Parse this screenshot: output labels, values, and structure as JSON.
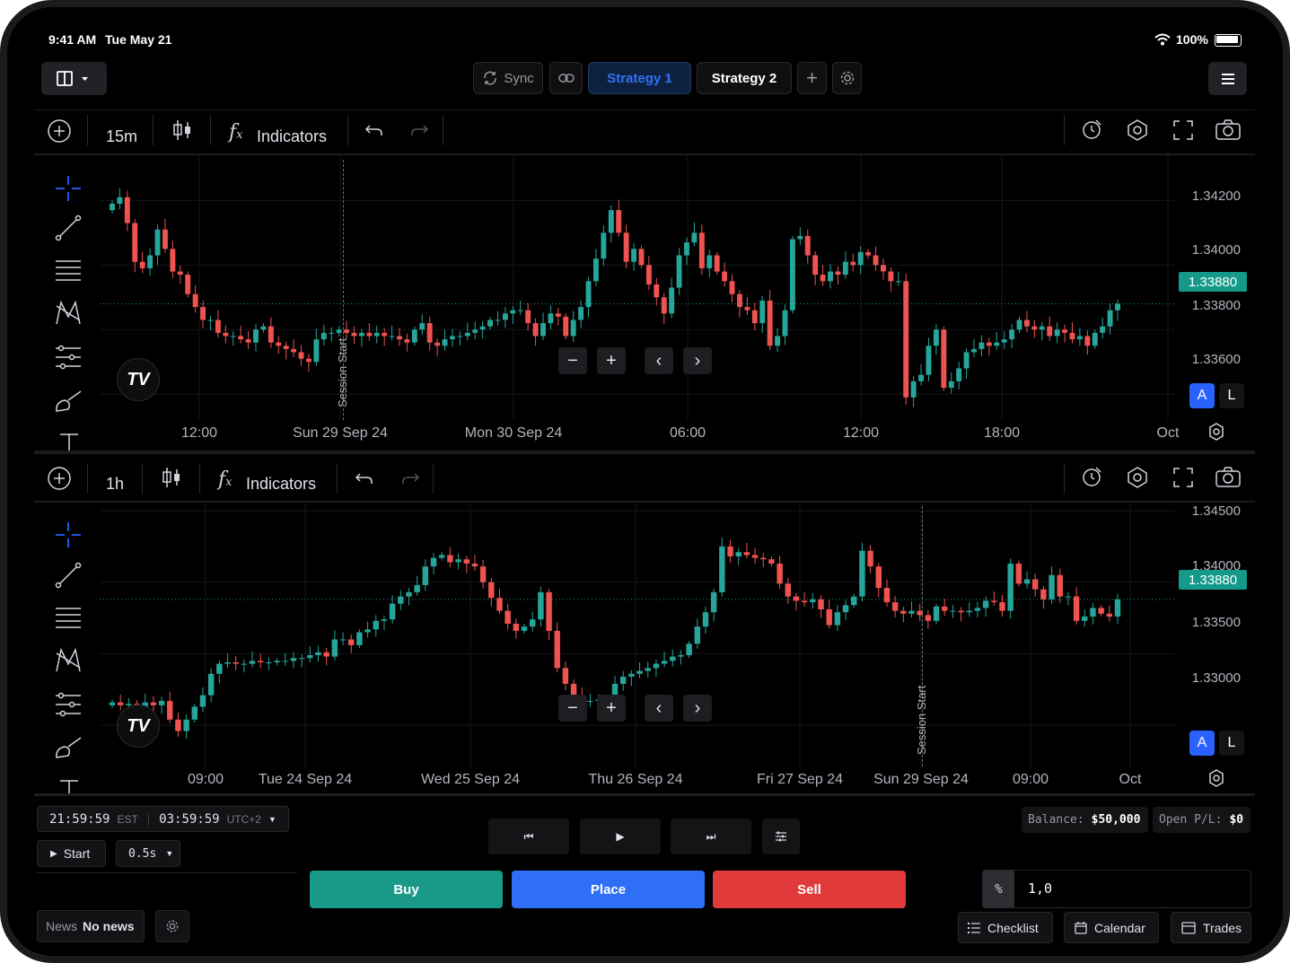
{
  "status_bar": {
    "time": "9:41 AM",
    "date": "Tue May 21",
    "battery": "100%",
    "icons": [
      "wifi-icon",
      "battery-icon"
    ]
  },
  "top_toolbar": {
    "layout_icon": "split-layout-icon",
    "sync_label": "Sync",
    "strategy_tabs": [
      {
        "label": "Strategy 1",
        "active": true
      },
      {
        "label": "Strategy 2",
        "active": false
      }
    ],
    "icons": [
      "link-icon",
      "plus-icon",
      "gear-icon",
      "menu-icon"
    ]
  },
  "chart_top": {
    "timeframe": "15m",
    "indicators_label": "Indicators",
    "last_price": "1.33880",
    "price_labels": [
      "1.34200",
      "1.34000",
      "1.33800",
      "1.33600"
    ],
    "time_labels": [
      "12:00",
      "Sun 29 Sep 24",
      "Mon 30 Sep 24",
      "06:00",
      "12:00",
      "18:00",
      "Oct"
    ],
    "session_label": "Session Start",
    "auto_label": "A",
    "log_label": "L"
  },
  "chart_bottom": {
    "timeframe": "1h",
    "indicators_label": "Indicators",
    "last_price": "1.33880",
    "price_labels": [
      "1.34500",
      "1.34000",
      "1.33500",
      "1.33000"
    ],
    "time_labels": [
      "09:00",
      "Tue 24 Sep 24",
      "Wed 25 Sep 24",
      "Thu 26 Sep 24",
      "Fri 27 Sep 24",
      "Sun 29 Sep 24",
      "09:00",
      "Oct"
    ],
    "session_label": "Session Start",
    "auto_label": "A",
    "log_label": "L"
  },
  "chart_data": [
    {
      "type": "candlestick",
      "timeframe": "15m",
      "ylim": [
        1.3352,
        1.3434
      ],
      "price_ticks": [
        1.342,
        1.34,
        1.338,
        1.336
      ],
      "last_price": 1.3388,
      "closes": [
        1.3419,
        1.3421,
        1.3413,
        1.3401,
        1.3399,
        1.3403,
        1.3411,
        1.3405,
        1.3398,
        1.3397,
        1.3391,
        1.3387,
        1.3383,
        1.3383,
        1.3379,
        1.3378,
        1.3378,
        1.3377,
        1.3376,
        1.338,
        1.3381,
        1.3376,
        1.3375,
        1.3374,
        1.3373,
        1.3371,
        1.337,
        1.3377,
        1.3379,
        1.3379,
        1.338,
        1.3379,
        1.3378,
        1.3379,
        1.3378,
        1.3379,
        1.3378,
        1.3378,
        1.3377,
        1.3376,
        1.338,
        1.3382,
        1.3376,
        1.3375,
        1.3377,
        1.3378,
        1.3378,
        1.3379,
        1.338,
        1.3381,
        1.3383,
        1.3383,
        1.3385,
        1.3386,
        1.3386,
        1.3382,
        1.3378,
        1.3382,
        1.3385,
        1.3384,
        1.3378,
        1.3383,
        1.3387,
        1.3395,
        1.3402,
        1.341,
        1.3417,
        1.341,
        1.3401,
        1.3405,
        1.34,
        1.3394,
        1.339,
        1.3385,
        1.3393,
        1.3403,
        1.3407,
        1.341,
        1.3399,
        1.3403,
        1.3398,
        1.3395,
        1.3391,
        1.3387,
        1.3386,
        1.3382,
        1.3389,
        1.3375,
        1.3378,
        1.3386,
        1.3408,
        1.3409,
        1.3403,
        1.3397,
        1.3395,
        1.3398,
        1.3397,
        1.3401,
        1.34,
        1.3404,
        1.3403,
        1.34,
        1.3398,
        1.3395,
        1.3395,
        1.3359,
        1.3364,
        1.3366,
        1.3375,
        1.338,
        1.3362,
        1.3364,
        1.3368,
        1.3373,
        1.3374,
        1.3376,
        1.3375,
        1.3376,
        1.3377,
        1.338,
        1.3383,
        1.3381,
        1.338,
        1.3381,
        1.3378,
        1.338,
        1.3379,
        1.3377,
        1.3378,
        1.3375,
        1.3379,
        1.3381,
        1.3386,
        1.3388
      ]
    },
    {
      "type": "candlestick",
      "timeframe": "1h",
      "ylim": [
        1.327,
        1.3455
      ],
      "price_ticks": [
        1.345,
        1.34,
        1.335,
        1.33
      ],
      "last_price": 1.3388,
      "closes": [
        1.3316,
        1.3314,
        1.3315,
        1.3313,
        1.3316,
        1.3314,
        1.3317,
        1.3304,
        1.3296,
        1.3304,
        1.3313,
        1.3321,
        1.3336,
        1.3343,
        1.3344,
        1.3343,
        1.3343,
        1.3345,
        1.3344,
        1.3344,
        1.3345,
        1.3345,
        1.3347,
        1.3347,
        1.3349,
        1.3351,
        1.3348,
        1.336,
        1.336,
        1.3356,
        1.3365,
        1.3367,
        1.3373,
        1.3374,
        1.3385,
        1.339,
        1.3393,
        1.3398,
        1.3411,
        1.3417,
        1.3419,
        1.3414,
        1.3416,
        1.3413,
        1.3411,
        1.34,
        1.3389,
        1.338,
        1.3371,
        1.3366,
        1.3369,
        1.3374,
        1.3393,
        1.3366,
        1.334,
        1.3329,
        1.332,
        1.3317,
        1.3317,
        1.3318,
        1.3317,
        1.3329,
        1.3334,
        1.3336,
        1.3338,
        1.334,
        1.3343,
        1.3345,
        1.3348,
        1.3349,
        1.3357,
        1.3369,
        1.3379,
        1.3393,
        1.3425,
        1.3418,
        1.3421,
        1.3419,
        1.3417,
        1.3416,
        1.3413,
        1.3399,
        1.339,
        1.3387,
        1.3386,
        1.3388,
        1.3381,
        1.337,
        1.3379,
        1.3384,
        1.339,
        1.3422,
        1.3411,
        1.3396,
        1.3386,
        1.338,
        1.3378,
        1.338,
        1.3377,
        1.3373,
        1.3383,
        1.338,
        1.338,
        1.3379,
        1.338,
        1.3382,
        1.3387,
        1.3386,
        1.338,
        1.3413,
        1.3399,
        1.3402,
        1.3395,
        1.3388,
        1.3405,
        1.339,
        1.339,
        1.3373,
        1.3376,
        1.3382,
        1.3378,
        1.3376,
        1.3388
      ]
    }
  ],
  "bottom_panel": {
    "clock_est": "21:59:59",
    "clock_est_tz": "EST",
    "clock_local": "03:59:59",
    "clock_local_tz": "UTC+2",
    "start_label": "Start",
    "speed": "0.5s",
    "buy_label": "Buy",
    "place_label": "Place",
    "sell_label": "Sell",
    "balance_label": "Balance:",
    "balance_value": "$50,000",
    "openpl_label": "Open P/L:",
    "openpl_value": "$0",
    "qty_mode": "%",
    "qty_value": "1,0",
    "news_label": "News",
    "news_value": "No news",
    "checklist_label": "Checklist",
    "calendar_label": "Calendar",
    "trades_label": "Trades",
    "colors": {
      "buy": "#1a9988",
      "place": "#2f6ff5",
      "sell": "#e03a3a",
      "up": "#26a69a",
      "down": "#ef5350",
      "accent": "#2962ff"
    }
  }
}
